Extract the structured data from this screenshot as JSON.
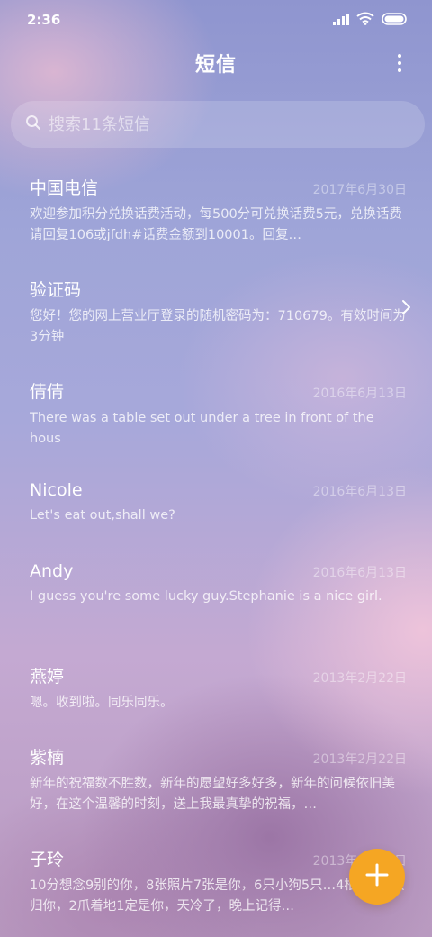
{
  "status": {
    "time": "2:36",
    "icons": [
      "signal-icon",
      "wifi-icon",
      "battery-icon"
    ]
  },
  "header": {
    "title": "短信",
    "menu_icon": "more-vertical-icon"
  },
  "search": {
    "placeholder": "搜索11条短信",
    "value": "",
    "icon": "search-icon"
  },
  "messages": [
    {
      "name": "中国电信",
      "date": "2017年6月30日",
      "preview": "欢迎参加积分兑换话费活动，每500分可兑换话费5元，兑换话费请回复106或jfdh#话费金额到10001。回复…"
    },
    {
      "name": "验证码",
      "date": "",
      "preview": "您好！您的网上营业厅登录的随机密码为：710679。有效时间为3分钟"
    },
    {
      "name": "倩倩",
      "date": "2016年6月13日",
      "preview": "There was a table set out under a tree in front of the hous"
    },
    {
      "name": "Nicole",
      "date": "2016年6月13日",
      "preview": "Let's eat out,shall we?"
    },
    {
      "name": "Andy",
      "date": "2016年6月13日",
      "preview": "I guess you're some lucky guy.Stephanie is a nice girl."
    },
    {
      "name": "燕婷",
      "date": "2013年2月22日",
      "preview": "嗯。收到啦。同乐同乐。"
    },
    {
      "name": "紫楠",
      "date": "2013年2月22日",
      "preview": "新年的祝福数不胜数，新年的愿望好多好多，新年的问候依旧美好，在这个温馨的时刻，送上我最真挚的祝福，…"
    },
    {
      "name": "子玲",
      "date": "2013年2月22日",
      "preview": "10分想念9别的你，8张照片7张是你，6只小狗5只…4根骨头3根归你，2爪着地1定是你，天冷了，晚上记得…"
    }
  ],
  "fab": {
    "icon": "plus-icon",
    "color": "#f5a623"
  }
}
